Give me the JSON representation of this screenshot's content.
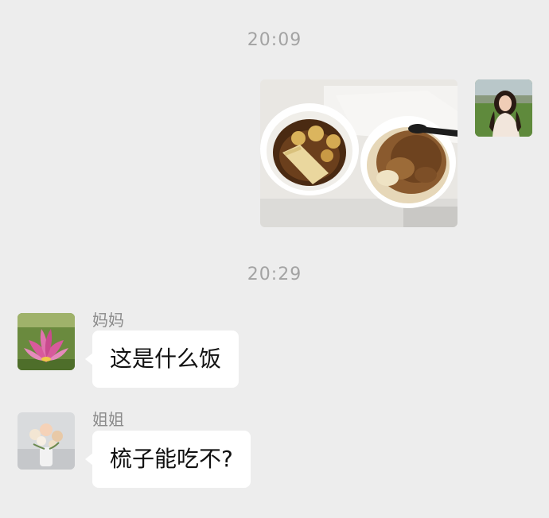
{
  "messages": [
    {
      "time": "20:09",
      "sender": "self",
      "type": "image",
      "image_description": "photo"
    },
    {
      "time": "20:29",
      "sender_name": "妈妈",
      "type": "text",
      "text": "这是什么饭"
    },
    {
      "sender_name": "姐姐",
      "type": "text",
      "text": "梳子能吃不?"
    }
  ],
  "colors": {
    "background": "#ededed",
    "bubble": "#ffffff",
    "timestamp": "#a3a3a3",
    "name": "#8a8a8a"
  }
}
